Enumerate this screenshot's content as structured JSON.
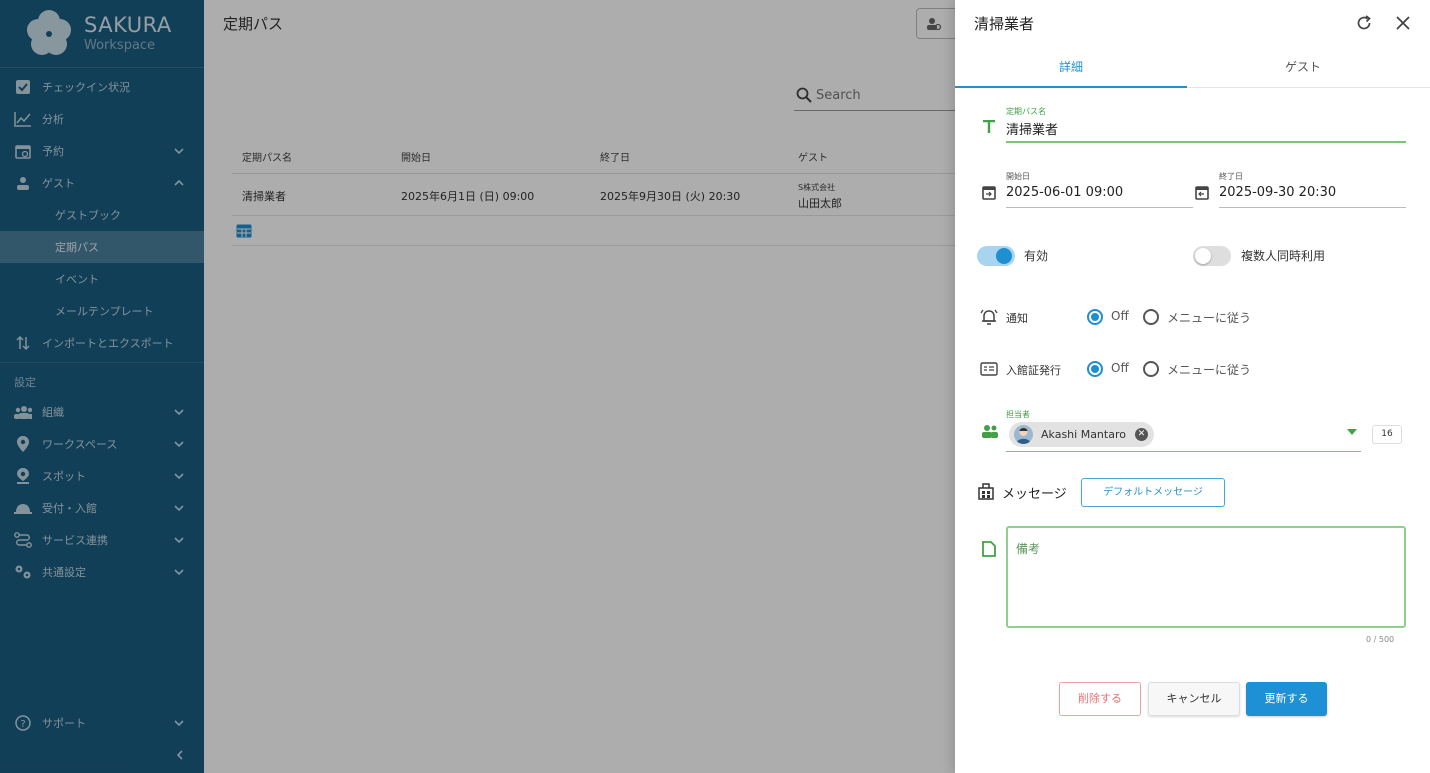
{
  "colors": {
    "sidebar_bg": "#1a5d80",
    "accent": "#1e90d6",
    "green": "#4caf50",
    "danger": "#e57373"
  },
  "brand": {
    "name": "SAKURA",
    "sub": "Workspace"
  },
  "sidebar": {
    "items": [
      {
        "label": "チェックイン状況",
        "icon": "checkbox-icon"
      },
      {
        "label": "分析",
        "icon": "chart-line-icon"
      },
      {
        "label": "予約",
        "icon": "calendar-icon"
      },
      {
        "label": "ゲスト",
        "icon": "person-icon"
      },
      {
        "label": "ゲストブック"
      },
      {
        "label": "定期パス"
      },
      {
        "label": "イベント"
      },
      {
        "label": "メールテンプレート"
      },
      {
        "label": "インポートとエクスポート",
        "icon": "import-export-icon"
      }
    ],
    "settings_label": "設定",
    "settings_items": [
      {
        "label": "組織",
        "icon": "group-icon"
      },
      {
        "label": "ワークスペース",
        "icon": "location-pin-icon"
      },
      {
        "label": "スポット",
        "icon": "spot-pin-icon"
      },
      {
        "label": "受付・入館",
        "icon": "reception-icon"
      },
      {
        "label": "サービス連携",
        "icon": "integration-icon"
      },
      {
        "label": "共通設定",
        "icon": "settings-icon"
      }
    ],
    "support_label": "サポート"
  },
  "main": {
    "title": "定期パス",
    "search_placeholder": "Search",
    "table": {
      "headers": [
        "定期パス名",
        "開始日",
        "終了日",
        "ゲスト"
      ],
      "rows": [
        {
          "name": "清掃業者",
          "start": "2025年6月1日 (日) 09:00",
          "end": "2025年9月30日 (火) 20:30",
          "guest_company": "S株式会社",
          "guest_name": "山田太郎"
        }
      ]
    }
  },
  "drawer": {
    "title": "清掃業者",
    "tabs": [
      "詳細",
      "ゲスト"
    ],
    "pass_name": {
      "label": "定期パス名",
      "value": "清掃業者"
    },
    "start": {
      "label": "開始日",
      "value": "2025-06-01 09:00"
    },
    "end": {
      "label": "終了日",
      "value": "2025-09-30 20:30"
    },
    "toggles": [
      {
        "label": "有効",
        "on": true
      },
      {
        "label": "複数人同時利用",
        "on": false
      }
    ],
    "notify": {
      "label": "通知",
      "options": [
        "Off",
        "メニューに従う"
      ],
      "selected": "Off"
    },
    "badge_issue": {
      "label": "入館証発行",
      "options": [
        "Off",
        "メニューに従う"
      ],
      "selected": "Off"
    },
    "assignee": {
      "label": "担当者",
      "chip": "Akashi Mantaro",
      "count": "16"
    },
    "message": {
      "label": "メッセージ",
      "default_button": "デフォルトメッセージ"
    },
    "notes": {
      "placeholder": "備考",
      "counter": "0 / 500"
    },
    "buttons": {
      "delete": "削除する",
      "cancel": "キャンセル",
      "update": "更新する"
    }
  }
}
